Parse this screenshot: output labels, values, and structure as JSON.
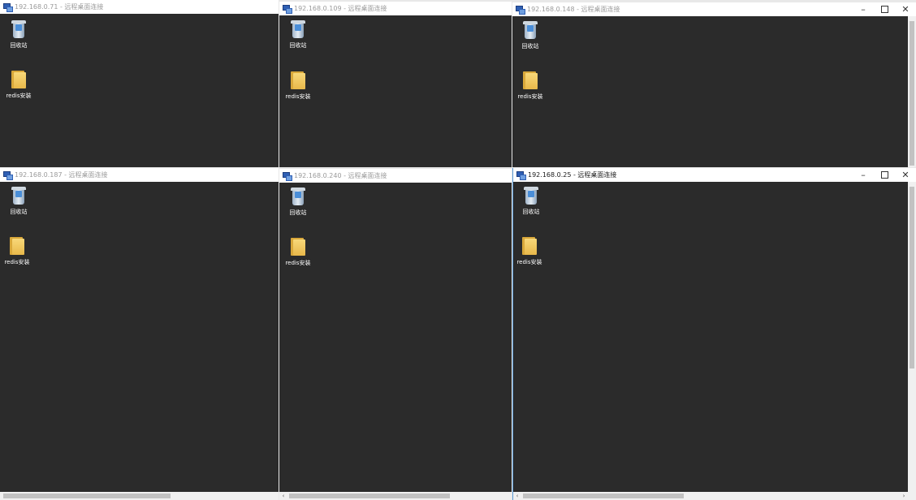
{
  "windows": [
    {
      "id": "w1",
      "title": "192.168.0.71 - 远程桌面连接",
      "active": false,
      "controls": false
    },
    {
      "id": "w2",
      "title": "192.168.0.109 - 远程桌面连接",
      "active": false,
      "controls": false
    },
    {
      "id": "w3",
      "title": "192.168.0.148 - 远程桌面连接",
      "active": false,
      "controls": true
    },
    {
      "id": "w4",
      "title": "192.168.0.187 - 远程桌面连接",
      "active": false,
      "controls": false
    },
    {
      "id": "w5",
      "title": "192.168.0.240 - 远程桌面连接",
      "active": false,
      "controls": false
    },
    {
      "id": "w6",
      "title": "192.168.0.25 - 远程桌面连接",
      "active": true,
      "controls": true
    }
  ],
  "desktop": {
    "recycle_bin_label": "回收站",
    "folder_label": "redis安装"
  },
  "controls": {
    "minimize": "–",
    "close": "✕"
  },
  "scroll": {
    "left_arrow": "‹",
    "right_arrow": "›"
  }
}
